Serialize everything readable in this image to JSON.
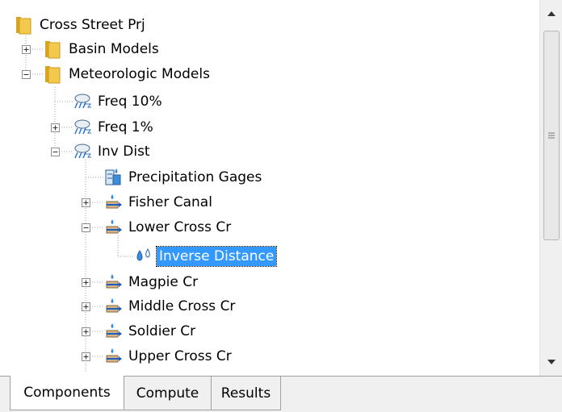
{
  "tree": {
    "root": "Cross Street Prj",
    "basin_models": "Basin Models",
    "meteorologic_models": "Meteorologic Models",
    "freq10": "Freq 10%",
    "freq1": "Freq 1%",
    "invdist": "Inv Dist",
    "precip_gages": "Precipitation Gages",
    "fisher_canal": "Fisher Canal",
    "lower_cross": "Lower Cross Cr",
    "inverse_distance": "Inverse Distance",
    "magpie": "Magpie Cr",
    "middle_cross": "Middle Cross Cr",
    "soldier": "Soldier Cr",
    "upper_cross": "Upper Cross Cr"
  },
  "tabs": {
    "components": "Components",
    "compute": "Compute",
    "results": "Results"
  },
  "colors": {
    "selection": "#3399ff",
    "folder": "#f2c94c",
    "water": "#3a8fd8"
  },
  "icons": {
    "folder": "folder-icon",
    "weather": "weather-icon",
    "gage": "gage-icon",
    "subbasin": "subbasin-icon",
    "drops": "water-drops-icon"
  }
}
